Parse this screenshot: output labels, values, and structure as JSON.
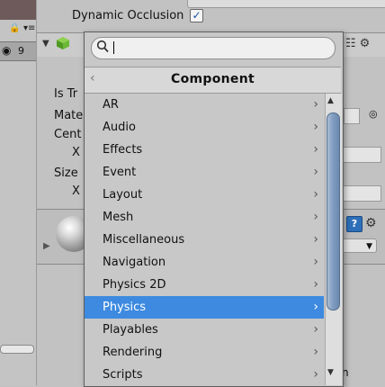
{
  "inspector": {
    "dynamic_occlusion_label": "Dynamic Occlusion",
    "dynamic_occlusion_checked": true,
    "visible_layers_count": "9",
    "properties": [
      {
        "label": "Is Tr"
      },
      {
        "label": "Mate"
      },
      {
        "label": "Cent"
      },
      {
        "label": "X"
      },
      {
        "label": "Size"
      },
      {
        "label": "X"
      }
    ],
    "bottom_fragment": "n"
  },
  "popup": {
    "search": {
      "value": "",
      "placeholder": ""
    },
    "title": "Component",
    "items": [
      {
        "label": "AR",
        "has_submenu": true
      },
      {
        "label": "Audio",
        "has_submenu": true
      },
      {
        "label": "Effects",
        "has_submenu": true
      },
      {
        "label": "Event",
        "has_submenu": true
      },
      {
        "label": "Layout",
        "has_submenu": true
      },
      {
        "label": "Mesh",
        "has_submenu": true
      },
      {
        "label": "Miscellaneous",
        "has_submenu": true
      },
      {
        "label": "Navigation",
        "has_submenu": true
      },
      {
        "label": "Physics 2D",
        "has_submenu": true
      },
      {
        "label": "Physics",
        "has_submenu": true,
        "selected": true
      },
      {
        "label": "Playables",
        "has_submenu": true
      },
      {
        "label": "Rendering",
        "has_submenu": true
      },
      {
        "label": "Scripts",
        "has_submenu": true
      }
    ]
  },
  "colors": {
    "selection": "#3d8ae0",
    "panel_bg": "#c2c2c2",
    "scroll_thumb": "#7f9bc0"
  },
  "icons": {
    "search": "search-icon",
    "back": "chevron-left-icon",
    "submenu": "chevron-right-icon",
    "cube": "cube-icon",
    "help": "help-icon",
    "lock": "lock-icon",
    "eye": "eye-icon",
    "gear": "gear-icon"
  }
}
